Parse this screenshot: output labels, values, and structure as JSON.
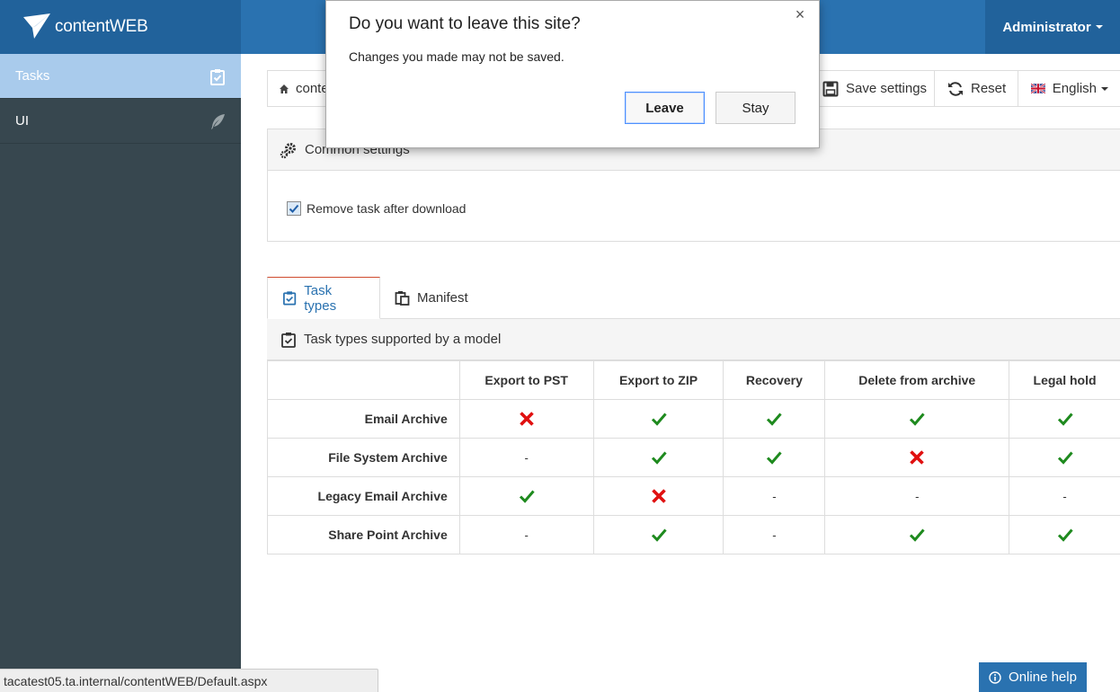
{
  "header": {
    "brand": "contentWEB",
    "user": "Administrator"
  },
  "sidebar": {
    "items": [
      {
        "label": "Tasks",
        "icon": "clipboard-check-icon",
        "active": true
      },
      {
        "label": "UI",
        "icon": "feather-icon",
        "active": false
      }
    ]
  },
  "toolbar": {
    "breadcrumb": "conte",
    "save_label": "Save settings",
    "reset_label": "Reset",
    "language_label": "English"
  },
  "common_settings": {
    "title": "Common settings",
    "checkbox_label": "Remove task after download",
    "checked": true
  },
  "tabs": [
    {
      "label": "Task types",
      "active": true
    },
    {
      "label": "Manifest",
      "active": false
    }
  ],
  "task_types": {
    "title": "Task types supported by a model",
    "columns": [
      "Export to PST",
      "Export to ZIP",
      "Recovery",
      "Delete from archive",
      "Legal hold"
    ],
    "rows": [
      {
        "label": "Email Archive",
        "cells": [
          "cross",
          "check",
          "check",
          "check",
          "check"
        ]
      },
      {
        "label": "File System Archive",
        "cells": [
          "-",
          "check",
          "check",
          "cross",
          "check"
        ]
      },
      {
        "label": "Legacy Email Archive",
        "cells": [
          "check",
          "cross",
          "-",
          "-",
          "-"
        ]
      },
      {
        "label": "Share Point Archive",
        "cells": [
          "-",
          "check",
          "-",
          "check",
          "check"
        ]
      }
    ]
  },
  "dialog": {
    "title": "Do you want to leave this site?",
    "message": "Changes you made may not be saved.",
    "leave_label": "Leave",
    "stay_label": "Stay",
    "close_glyph": "×"
  },
  "status_url": "tacatest05.ta.internal/contentWEB/Default.aspx",
  "help_label": "Online help",
  "colors": {
    "header": "#2a72b0",
    "header_dark": "#21629b",
    "sidebar": "#37474f",
    "sidebar_active": "#a9cbec",
    "check": "#1e8a1e",
    "cross": "#e01010"
  }
}
